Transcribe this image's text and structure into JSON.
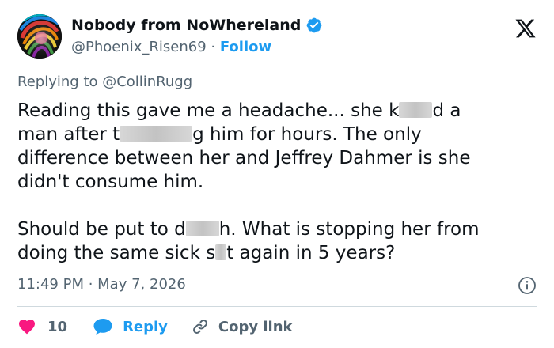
{
  "author": {
    "display_name": "Nobody from NoWhereland",
    "handle": "@Phoenix_Risen69",
    "separator": " · ",
    "follow_label": "Follow",
    "verified_color": "#1d9bf0",
    "avatar_icon": "rainbow-swirl-avatar"
  },
  "reply_context": {
    "prefix": "Replying to ",
    "mention": "@CollinRugg"
  },
  "tweet": {
    "p1": {
      "s1": "Reading this gave me a headache... she k",
      "s2": "d a",
      "s3": "man after t",
      "s4": "g him for hours. The only",
      "s5": "difference between her and Jeffrey Dahmer is she",
      "s6": "didn't consume him."
    },
    "p2": {
      "s1": "Should be put to d",
      "s2": "h.  What is stopping her from",
      "s3": "doing the same sick s",
      "s4": "t again in 5 years?"
    }
  },
  "timestamp": {
    "time": "11:49 PM",
    "separator": " · ",
    "date": "May 7, 2026"
  },
  "actions": {
    "like_count": "10",
    "reply_label": "Reply",
    "copy_link_label": "Copy link"
  },
  "colors": {
    "text_primary": "#0f1419",
    "text_secondary": "#536471",
    "accent_blue": "#1d9bf0",
    "heart_pink": "#f91880",
    "divider": "#cfd9de"
  },
  "icons": {
    "x_logo": "x-logo-icon",
    "info": "info-icon",
    "heart": "heart-icon",
    "reply": "speech-bubble-icon",
    "link": "link-icon"
  }
}
